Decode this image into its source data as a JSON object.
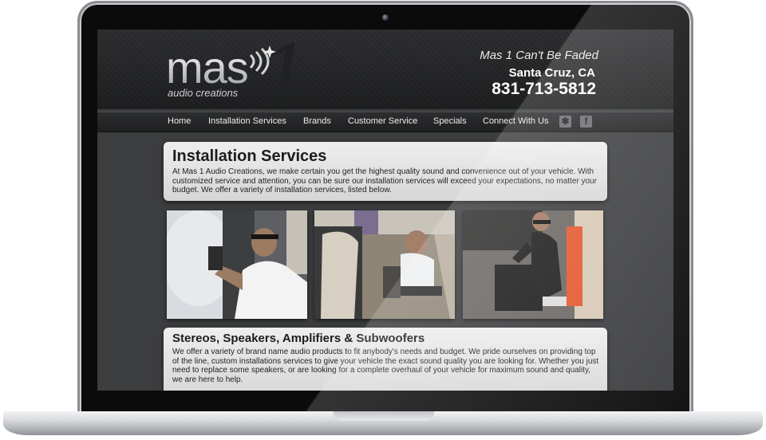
{
  "site": {
    "logo_main": "mas",
    "logo_numeral": "1",
    "logo_sub": "audio creations",
    "tagline": "Mas 1 Can't Be Faded",
    "city": "Santa Cruz, CA",
    "phone": "831-713-5812"
  },
  "nav": {
    "items": [
      {
        "label": "Home"
      },
      {
        "label": "Installation Services"
      },
      {
        "label": "Brands"
      },
      {
        "label": "Customer Service"
      },
      {
        "label": "Specials"
      },
      {
        "label": "Connect With Us"
      }
    ],
    "social": [
      "yelp-icon",
      "facebook-icon"
    ],
    "facebook_glyph": "f",
    "yelp_glyph": "✱"
  },
  "intro": {
    "title": "Installation Services",
    "body": "At Mas 1 Audio Creations, we make certain you get the highest quality sound and convenience out of your vehicle. With customized service and attention, you can be sure our installation services will exceed your expectations, no matter your budget. We offer a variety of installation services, listed below."
  },
  "photos": [
    {
      "subject": "technician-installing-door-panel"
    },
    {
      "subject": "technician-in-car-seat"
    },
    {
      "subject": "technician-with-subwoofer-box"
    }
  ],
  "section": {
    "title": "Stereos, Speakers, Amplifiers & Subwoofers",
    "body": "We offer a variety of brand name audio products to fit anybody's needs and budget. We pride ourselves on providing top of the line, custom installations services to give your vehicle the exact sound quality you are looking for. Whether you just need to replace some speakers, or are looking for a complete overhaul of your vehicle for maximum sound and quality, we are here to help."
  },
  "colors": {
    "bezel": "#0b0b0c",
    "header_bg": "#1b1c1d",
    "body_bg": "#3c3d3f",
    "panel_bg": "#e4e4e4",
    "text_dark": "#1c1c1c"
  }
}
